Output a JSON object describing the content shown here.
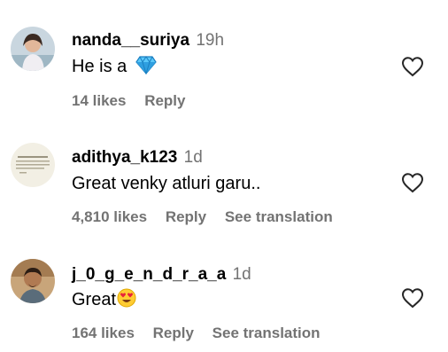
{
  "comments": [
    {
      "username": "nanda__suriya",
      "time": "19h",
      "text": "He is a",
      "emoji_icon": "gem-icon",
      "likes": "14 likes",
      "reply": "Reply",
      "translation": ""
    },
    {
      "username": "adithya_k123",
      "time": "1d",
      "text": "Great venky atluri garu..",
      "emoji_icon": "",
      "likes": "4,810 likes",
      "reply": "Reply",
      "translation": "See translation"
    },
    {
      "username": "j_0_g_e_n_d_r_a_a",
      "time": "1d",
      "text": "Great",
      "emoji_icon": "heart-eyes-emoji-icon",
      "likes": "164 likes",
      "reply": "Reply",
      "translation": "See translation"
    }
  ],
  "colors": {
    "text_primary": "#000000",
    "text_secondary": "#737373",
    "heart_outline": "#262626",
    "gem": "#1da1f2"
  }
}
